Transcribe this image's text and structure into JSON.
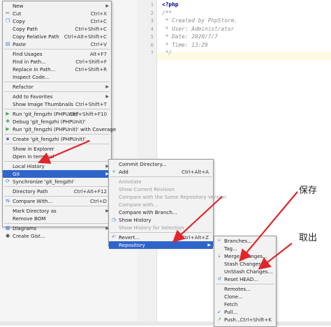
{
  "editor": {
    "gutter_lines": [
      "1",
      "2",
      "3",
      "4",
      "5",
      "6",
      "7"
    ],
    "lines": [
      {
        "text": "<?php",
        "kind": "php"
      },
      {
        "text": "/**",
        "kind": "comment"
      },
      {
        "text": " * Created by PhpStorm.",
        "kind": "comment"
      },
      {
        "text": " * User: Administrator",
        "kind": "comment"
      },
      {
        "text": " * Date: 2020/7/7",
        "kind": "comment"
      },
      {
        "text": " * Time: 13:29",
        "kind": "comment"
      },
      {
        "text": " */",
        "kind": "comment"
      }
    ]
  },
  "context_menu": {
    "items": [
      {
        "label": "New",
        "shortcut": "",
        "arrow": true,
        "icon": ""
      },
      {
        "label": "Cut",
        "shortcut": "Ctrl+X",
        "icon": "cut-icon"
      },
      {
        "label": "Copy",
        "shortcut": "Ctrl+C",
        "icon": "copy-icon"
      },
      {
        "label": "Copy Path",
        "shortcut": "Ctrl+Shift+C",
        "icon": ""
      },
      {
        "label": "Copy Relative Path",
        "shortcut": "Ctrl+Alt+Shift+C",
        "icon": ""
      },
      {
        "label": "Paste",
        "shortcut": "Ctrl+V",
        "icon": "paste-icon"
      },
      {
        "sep": true
      },
      {
        "label": "Find Usages",
        "shortcut": "Alt+F7",
        "icon": ""
      },
      {
        "label": "Find in Path...",
        "shortcut": "Ctrl+Shift+F",
        "icon": ""
      },
      {
        "label": "Replace in Path...",
        "shortcut": "Ctrl+Shift+R",
        "icon": ""
      },
      {
        "label": "Inspect Code...",
        "shortcut": "",
        "icon": ""
      },
      {
        "sep": true
      },
      {
        "label": "Refactor",
        "shortcut": "",
        "arrow": true,
        "icon": ""
      },
      {
        "sep": true
      },
      {
        "label": "Add to Favorites",
        "shortcut": "",
        "arrow": true,
        "icon": ""
      },
      {
        "label": "Show Image Thumbnails",
        "shortcut": "Ctrl+Shift+T",
        "icon": ""
      },
      {
        "sep": true
      },
      {
        "label": "Run 'git_fengzhi (PHPUnit)'",
        "shortcut": "Ctrl+Shift+F10",
        "icon": "run-icon"
      },
      {
        "label": "Debug 'git_fengzhi (PHPUnit)'",
        "shortcut": "",
        "icon": "debug-icon"
      },
      {
        "label": "Run 'git_fengzhi (PHPUnit)' with Coverage",
        "shortcut": "",
        "icon": "coverage-icon"
      },
      {
        "sep": true
      },
      {
        "label": "Create 'git_fengzhi (PHPUnit)'...",
        "shortcut": "",
        "icon": "create-icon"
      },
      {
        "sep": true
      },
      {
        "label": "Show in Explorer",
        "shortcut": "",
        "icon": ""
      },
      {
        "label": "Open in terminal",
        "shortcut": "",
        "icon": ""
      },
      {
        "sep": true
      },
      {
        "label": "Local History",
        "shortcut": "",
        "arrow": true,
        "icon": ""
      },
      {
        "label": "Git",
        "shortcut": "",
        "arrow": true,
        "icon": "",
        "selected": true
      },
      {
        "label": "Synchronize 'git_fengzhi'",
        "shortcut": "",
        "icon": "sync-icon"
      },
      {
        "sep": true
      },
      {
        "label": "Directory Path",
        "shortcut": "Ctrl+Alt+F12",
        "icon": ""
      },
      {
        "sep": true
      },
      {
        "label": "Compare With...",
        "shortcut": "Ctrl+D",
        "icon": "compare-icon"
      },
      {
        "sep": true
      },
      {
        "label": "Mark Directory as",
        "shortcut": "",
        "arrow": true,
        "icon": ""
      },
      {
        "label": "Remove BOM",
        "shortcut": "",
        "icon": ""
      },
      {
        "sep": true
      },
      {
        "label": "Diagrams",
        "shortcut": "",
        "arrow": true,
        "icon": "diagram-icon"
      },
      {
        "label": "Create Gist...",
        "shortcut": "",
        "icon": "gist-icon"
      }
    ]
  },
  "git_menu": {
    "items": [
      {
        "label": "Commit Directory...",
        "shortcut": "",
        "icon": ""
      },
      {
        "label": "Add",
        "shortcut": "Ctrl+Alt+A",
        "icon": "add-icon"
      },
      {
        "sep": true
      },
      {
        "label": "Annotate",
        "shortcut": "",
        "icon": "",
        "disabled": true
      },
      {
        "label": "Show Current Revision",
        "shortcut": "",
        "icon": "",
        "disabled": true
      },
      {
        "label": "Compare with the Same Repository Version",
        "shortcut": "",
        "icon": "",
        "disabled": true
      },
      {
        "label": "Compare with...",
        "shortcut": "",
        "icon": "",
        "disabled": true
      },
      {
        "label": "Compare with Branch...",
        "shortcut": "",
        "icon": ""
      },
      {
        "label": "Show History",
        "shortcut": "",
        "icon": "history-icon"
      },
      {
        "label": "Show History for Selection",
        "shortcut": "",
        "icon": "",
        "disabled": true
      },
      {
        "sep": true
      },
      {
        "label": "Revert...",
        "shortcut": "Ctrl+Alt+Z",
        "icon": "revert-icon"
      },
      {
        "label": "Repository",
        "shortcut": "",
        "arrow": true,
        "icon": "",
        "selected": true
      }
    ]
  },
  "repository_menu": {
    "items": [
      {
        "label": "Branches...",
        "shortcut": "",
        "icon": "branch-icon"
      },
      {
        "label": "Tag...",
        "shortcut": "",
        "icon": ""
      },
      {
        "label": "Merge Changes...",
        "shortcut": "",
        "icon": "merge-icon"
      },
      {
        "label": "Stash Changes...",
        "shortcut": "",
        "icon": ""
      },
      {
        "label": "UnStash Changes...",
        "shortcut": "",
        "icon": ""
      },
      {
        "label": "Reset HEAD...",
        "shortcut": "",
        "icon": "reset-icon"
      },
      {
        "sep": true
      },
      {
        "label": "Remotes...",
        "shortcut": "",
        "icon": ""
      },
      {
        "label": "Clone...",
        "shortcut": "",
        "icon": ""
      },
      {
        "label": "Fetch",
        "shortcut": "",
        "icon": ""
      },
      {
        "label": "Pull...",
        "shortcut": "",
        "icon": "pull-icon"
      },
      {
        "label": "Push...",
        "shortcut": "Ctrl+Shift+K",
        "icon": "push-icon"
      }
    ]
  },
  "annotations": {
    "save_label": "保存",
    "cancel_label": "取出"
  },
  "colors": {
    "selection": "#2f65ca",
    "arrow_red": "#e0262b"
  }
}
